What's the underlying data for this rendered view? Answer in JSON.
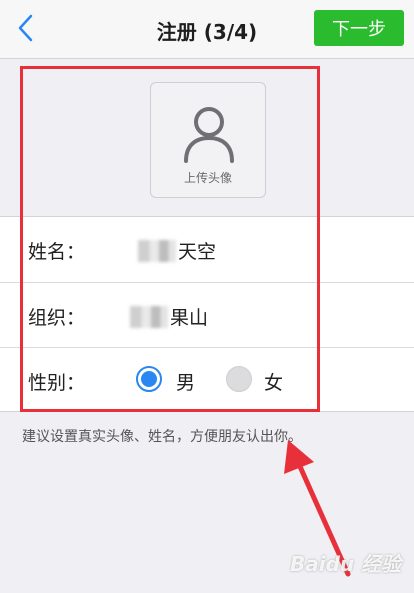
{
  "nav": {
    "title": "注册 (3/4)",
    "next_label": "下一步",
    "back_icon": "chevron-left-icon"
  },
  "avatar": {
    "label": "上传头像",
    "icon": "user-icon"
  },
  "form": {
    "name_label": "姓名：",
    "name_value": "天空",
    "org_label": "组织：",
    "org_value": "果山",
    "gender_label": "性别：",
    "gender_options": [
      "男",
      "女"
    ],
    "gender_selected": "男"
  },
  "hint": "建议设置真实头像、姓名，方便朋友认出你。",
  "watermark": "Baidu 经验",
  "colors": {
    "accent": "#2a87f1",
    "next_button": "#2bbb2f",
    "annotation": "#e8303a"
  }
}
